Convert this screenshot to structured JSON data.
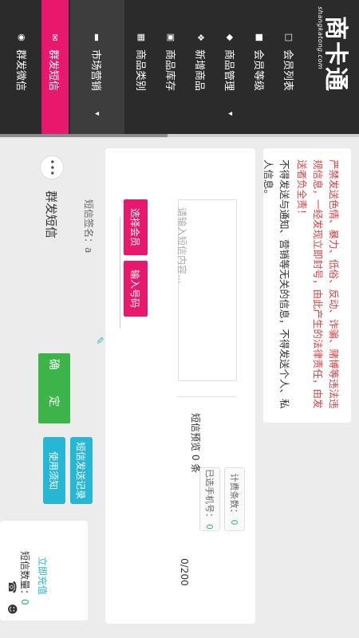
{
  "brand": {
    "name": "商卡通",
    "domain": "shangkatong.com"
  },
  "menu": [
    {
      "label": "会员列表",
      "icon": "user-list-icon"
    },
    {
      "label": "会员等级",
      "icon": "badge-icon"
    },
    {
      "label": "商品管理",
      "icon": "tag-icon",
      "caret": "▾"
    },
    {
      "label": "新增商品",
      "icon": "gift-icon"
    },
    {
      "label": "商品库存",
      "icon": "cart-icon"
    },
    {
      "label": "商品类别",
      "icon": "grid-icon"
    },
    {
      "label": "市场营销",
      "icon": "book-icon",
      "caret": "▾"
    },
    {
      "label": "群发短信",
      "icon": "sms-icon"
    },
    {
      "label": "群发微信",
      "icon": "palette-icon"
    }
  ],
  "page": {
    "title": "群发短信",
    "more": "•••"
  },
  "warning": {
    "red": "严禁发送色情、暴力、低俗、反动、诈骗、赌博等违法违规信息，一经发现立即封号，由此产生的法律责任，由发送者负全责！",
    "black": "不得发送与通知、营销等无关的信息，不得发送个人、私人信息。"
  },
  "buttons": {
    "select_member": "选择会员",
    "input_phone": "输入号码",
    "confirm": "确 定",
    "tip": "使用须知",
    "record": "短信发送记录"
  },
  "form": {
    "content_placeholder": "请输入短信内容...",
    "sign_label": "短信签名：a",
    "preview_label": "短信预览 0 条",
    "billing_label": "计费条数：",
    "billing_value": "0",
    "phone_label": "已选手机号：",
    "phone_value": "0",
    "char_count": "0/200"
  },
  "sms": {
    "count_label": "短信数量：",
    "count_value": "0",
    "recharge": "立即充值"
  },
  "colors": {
    "pink": "#e8196c",
    "teal": "#27b7d4",
    "green": "#3cb44a",
    "sidebar": "#2b2b2b"
  }
}
